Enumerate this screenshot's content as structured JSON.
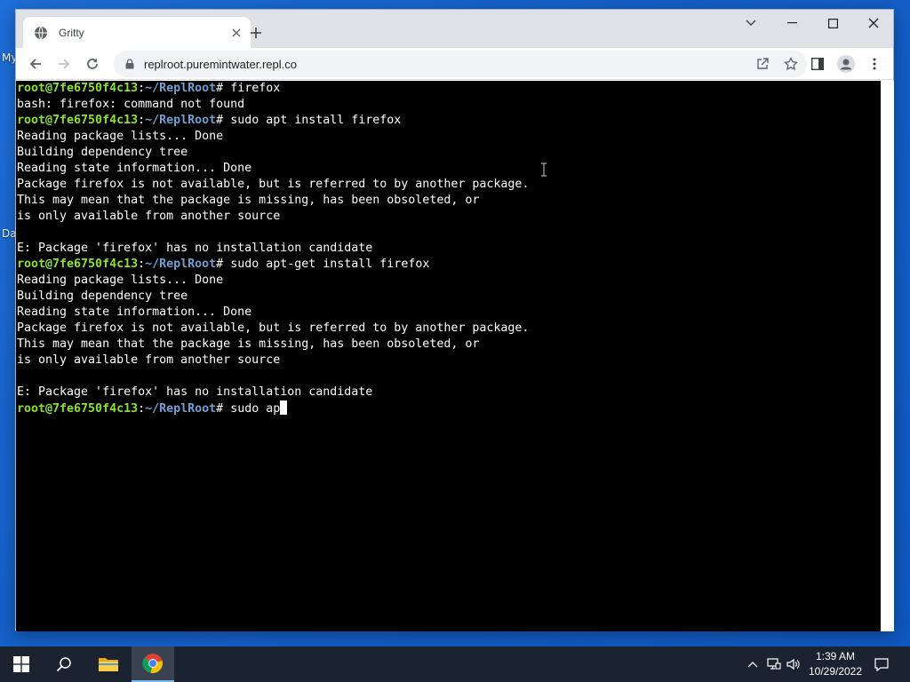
{
  "desktop": {
    "label_top": "My",
    "label_bottom": "Da"
  },
  "browser": {
    "tab_title": "Gritty",
    "tab_favicon": "globe-icon",
    "url": "replroot.puremintwater.repl.co"
  },
  "terminal": {
    "prompt_user": "root@7fe6750f4c13",
    "prompt_path": "~/ReplRoot",
    "prompt_symbol": "# ",
    "lines": [
      {
        "type": "prompt",
        "cmd": "firefox"
      },
      {
        "type": "out",
        "text": "bash: firefox: command not found"
      },
      {
        "type": "prompt",
        "cmd": "sudo apt install firefox"
      },
      {
        "type": "out",
        "text": "Reading package lists... Done"
      },
      {
        "type": "out",
        "text": "Building dependency tree"
      },
      {
        "type": "out",
        "text": "Reading state information... Done"
      },
      {
        "type": "out",
        "text": "Package firefox is not available, but is referred to by another package."
      },
      {
        "type": "out",
        "text": "This may mean that the package is missing, has been obsoleted, or"
      },
      {
        "type": "out",
        "text": "is only available from another source"
      },
      {
        "type": "out",
        "text": ""
      },
      {
        "type": "out",
        "text": "E: Package 'firefox' has no installation candidate"
      },
      {
        "type": "prompt",
        "cmd": "sudo apt-get install firefox"
      },
      {
        "type": "out",
        "text": "Reading package lists... Done"
      },
      {
        "type": "out",
        "text": "Building dependency tree"
      },
      {
        "type": "out",
        "text": "Reading state information... Done"
      },
      {
        "type": "out",
        "text": "Package firefox is not available, but is referred to by another package."
      },
      {
        "type": "out",
        "text": "This may mean that the package is missing, has been obsoleted, or"
      },
      {
        "type": "out",
        "text": "is only available from another source"
      },
      {
        "type": "out",
        "text": ""
      },
      {
        "type": "out",
        "text": "E: Package 'firefox' has no installation candidate"
      },
      {
        "type": "input",
        "cmd": "sudo ap"
      }
    ]
  },
  "taskbar": {
    "time": "1:39 AM",
    "date": "10/29/2022"
  },
  "colors": {
    "prompt_user": "#8ae234",
    "prompt_path": "#729fcf",
    "taskbar_bg": "#1c2330",
    "desktop_bg": "#1560c9"
  }
}
